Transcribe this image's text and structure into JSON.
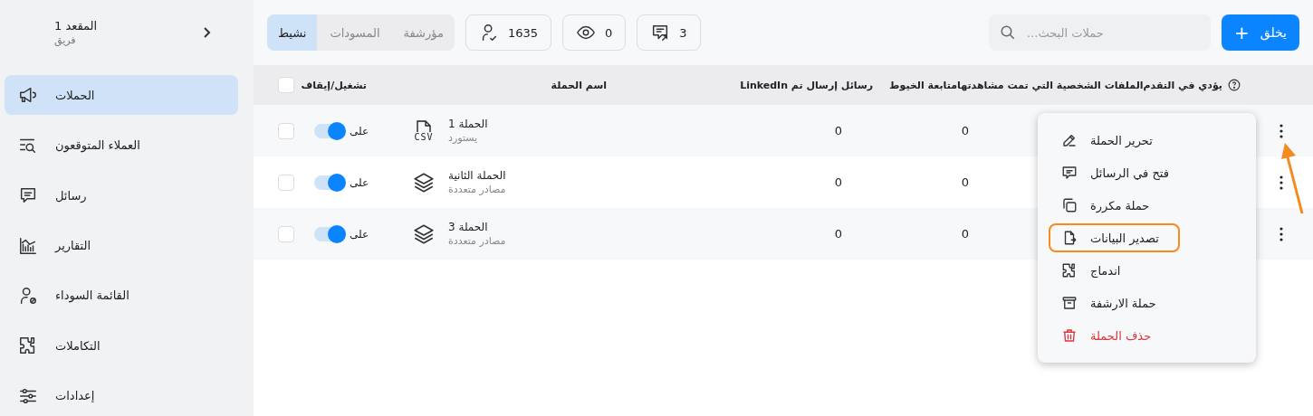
{
  "sidebar": {
    "workspace": {
      "title": "المقعد 1",
      "subtitle": "فريق"
    },
    "items": [
      {
        "label": "الحملات",
        "selected": true
      },
      {
        "label": "العملاء المتوقعون",
        "selected": false
      },
      {
        "label": "رسائل",
        "selected": false
      },
      {
        "label": "التقارير",
        "selected": false
      },
      {
        "label": "القائمة السوداء",
        "selected": false
      },
      {
        "label": "التكاملات",
        "selected": false
      },
      {
        "label": "إعدادات",
        "selected": false
      }
    ]
  },
  "toolbar": {
    "tabs": [
      {
        "label": "مؤرشفة",
        "selected": false
      },
      {
        "label": "المسودات",
        "selected": false
      },
      {
        "label": "نشيط",
        "selected": true
      }
    ],
    "stats": [
      {
        "value": "3"
      },
      {
        "value": "0"
      },
      {
        "value": "1635"
      }
    ],
    "search": {
      "placeholder": "حملات البحث..."
    },
    "create_button": {
      "label": "يخلق",
      "icon_text": "+"
    }
  },
  "table": {
    "all_selected": false,
    "columns": [
      "يؤدي في التقدم",
      "الملفات الشخصية التي تمت مشاهدتها",
      "متابعة الخيوط",
      "رسائل إرسال تم LinkedIn",
      "اسم الحملة",
      "تشغيل/إيقاف"
    ],
    "rows": [
      {
        "selected": false,
        "on": true,
        "status": "على",
        "kind": "file",
        "file_label": "CSV",
        "name": "الحملة 1",
        "source": "يستورد",
        "linkedin_sent": "0",
        "threads": "0"
      },
      {
        "selected": false,
        "on": true,
        "status": "على",
        "kind": "stack",
        "name": "الحملة الثانية",
        "source": "مصادر متعددة",
        "linkedin_sent": "0",
        "threads": "0"
      },
      {
        "selected": false,
        "on": true,
        "status": "على",
        "kind": "stack",
        "name": "الحملة 3",
        "source": "مصادر متعددة",
        "linkedin_sent": "0",
        "threads": "0"
      }
    ]
  },
  "menu": {
    "items": [
      {
        "label": "تحرير الحملة",
        "kind": "normal",
        "highlighted": false
      },
      {
        "label": "فتح في الرسائل",
        "kind": "normal",
        "highlighted": false
      },
      {
        "label": "حملة مكررة",
        "kind": "normal",
        "highlighted": false
      },
      {
        "label": "تصدير البيانات",
        "kind": "normal",
        "highlighted": true
      },
      {
        "label": "اندماج",
        "kind": "normal",
        "highlighted": false
      },
      {
        "label": "حملة الارشفة",
        "kind": "normal",
        "highlighted": false
      },
      {
        "label": "حذف الحملة",
        "kind": "danger",
        "highlighted": false
      }
    ]
  },
  "annotation_arrow": true
}
